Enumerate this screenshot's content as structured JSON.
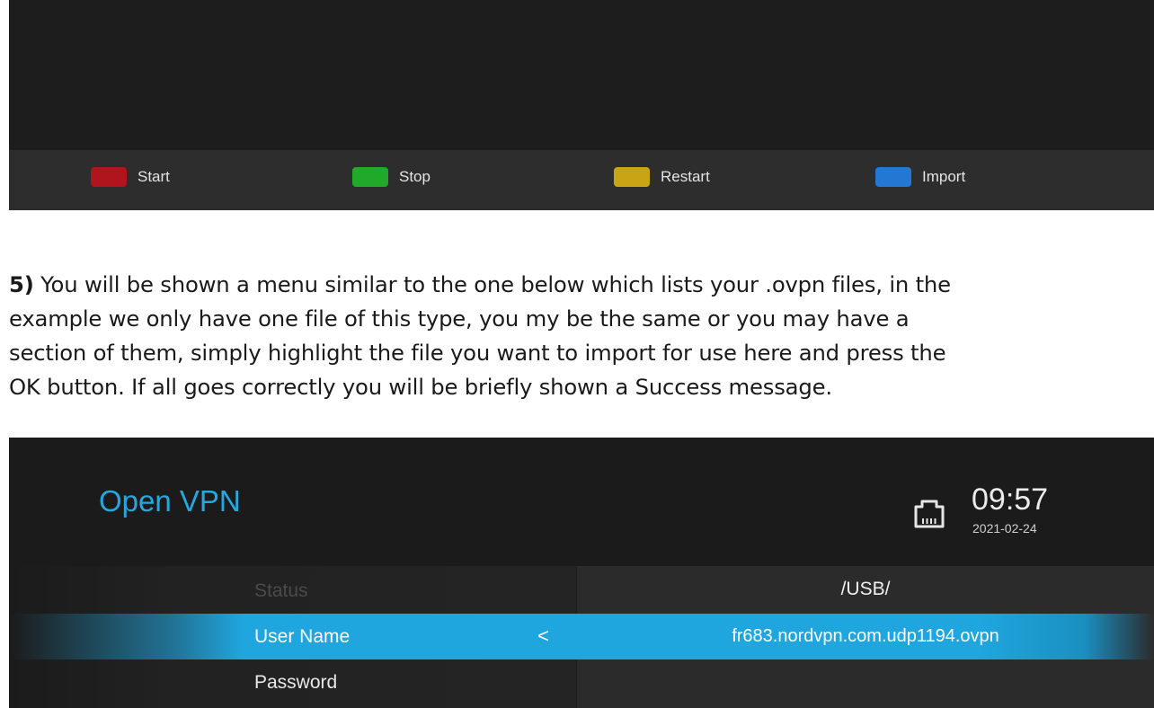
{
  "top_screenshot": {
    "buttons": [
      {
        "label": "Start",
        "color": "#b0141d"
      },
      {
        "label": "Stop",
        "color": "#1faa2a"
      },
      {
        "label": "Restart",
        "color": "#c9a515"
      },
      {
        "label": "Import",
        "color": "#2278d2"
      }
    ]
  },
  "paragraph": {
    "step_number": "5)",
    "lines": [
      " You will be shown a menu similar to the one below which lists your .ovpn files, in the",
      "example we only have one file of this type, you my be the same or you may have a",
      "section of them, simply highlight the file you want to import for use here and press the",
      "OK button. If all goes correctly you will be briefly shown a Success message."
    ]
  },
  "bottom_screenshot": {
    "title": "Open VPN",
    "time": "09:57",
    "date": "2021-02-24",
    "network_icon": "ethernet-icon",
    "accent_color": "#1fa6de",
    "menu": [
      {
        "label": "Status",
        "state": "dim"
      },
      {
        "label": "User Name",
        "state": "active",
        "indicator": "<"
      },
      {
        "label": "Password",
        "state": "normal"
      }
    ],
    "file_browser": {
      "path": "/USB/",
      "files": [
        "fr683.nordvpn.com.udp1194.ovpn"
      ]
    }
  }
}
